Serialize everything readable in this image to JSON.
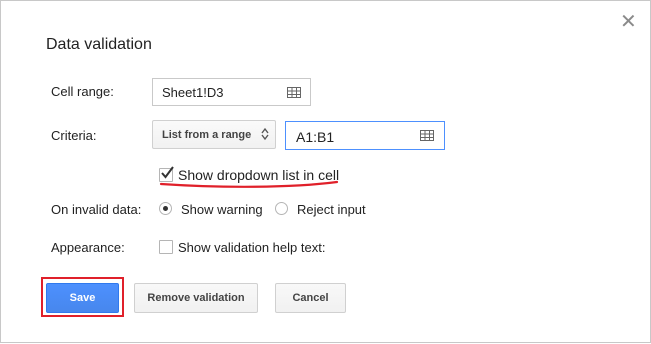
{
  "dialog": {
    "title": "Data validation",
    "close_icon": "close-icon"
  },
  "fields": {
    "cell_range": {
      "label": "Cell range:",
      "value": "Sheet1!D3"
    },
    "criteria": {
      "label": "Criteria:",
      "type_selected": "List from a range",
      "range_value": "A1:B1"
    },
    "dropdown_checkbox": {
      "label": "Show dropdown list in cell",
      "checked": true
    },
    "invalid_data": {
      "label": "On invalid data:",
      "options": [
        "Show warning",
        "Reject input"
      ],
      "selected": "Show warning"
    },
    "appearance": {
      "label": "Appearance:",
      "help_text_label": "Show validation help text:",
      "checked": false
    }
  },
  "buttons": {
    "save": "Save",
    "remove": "Remove validation",
    "cancel": "Cancel"
  },
  "colors": {
    "primary_blue": "#4d90fe",
    "annotation_red": "#e0202a"
  }
}
